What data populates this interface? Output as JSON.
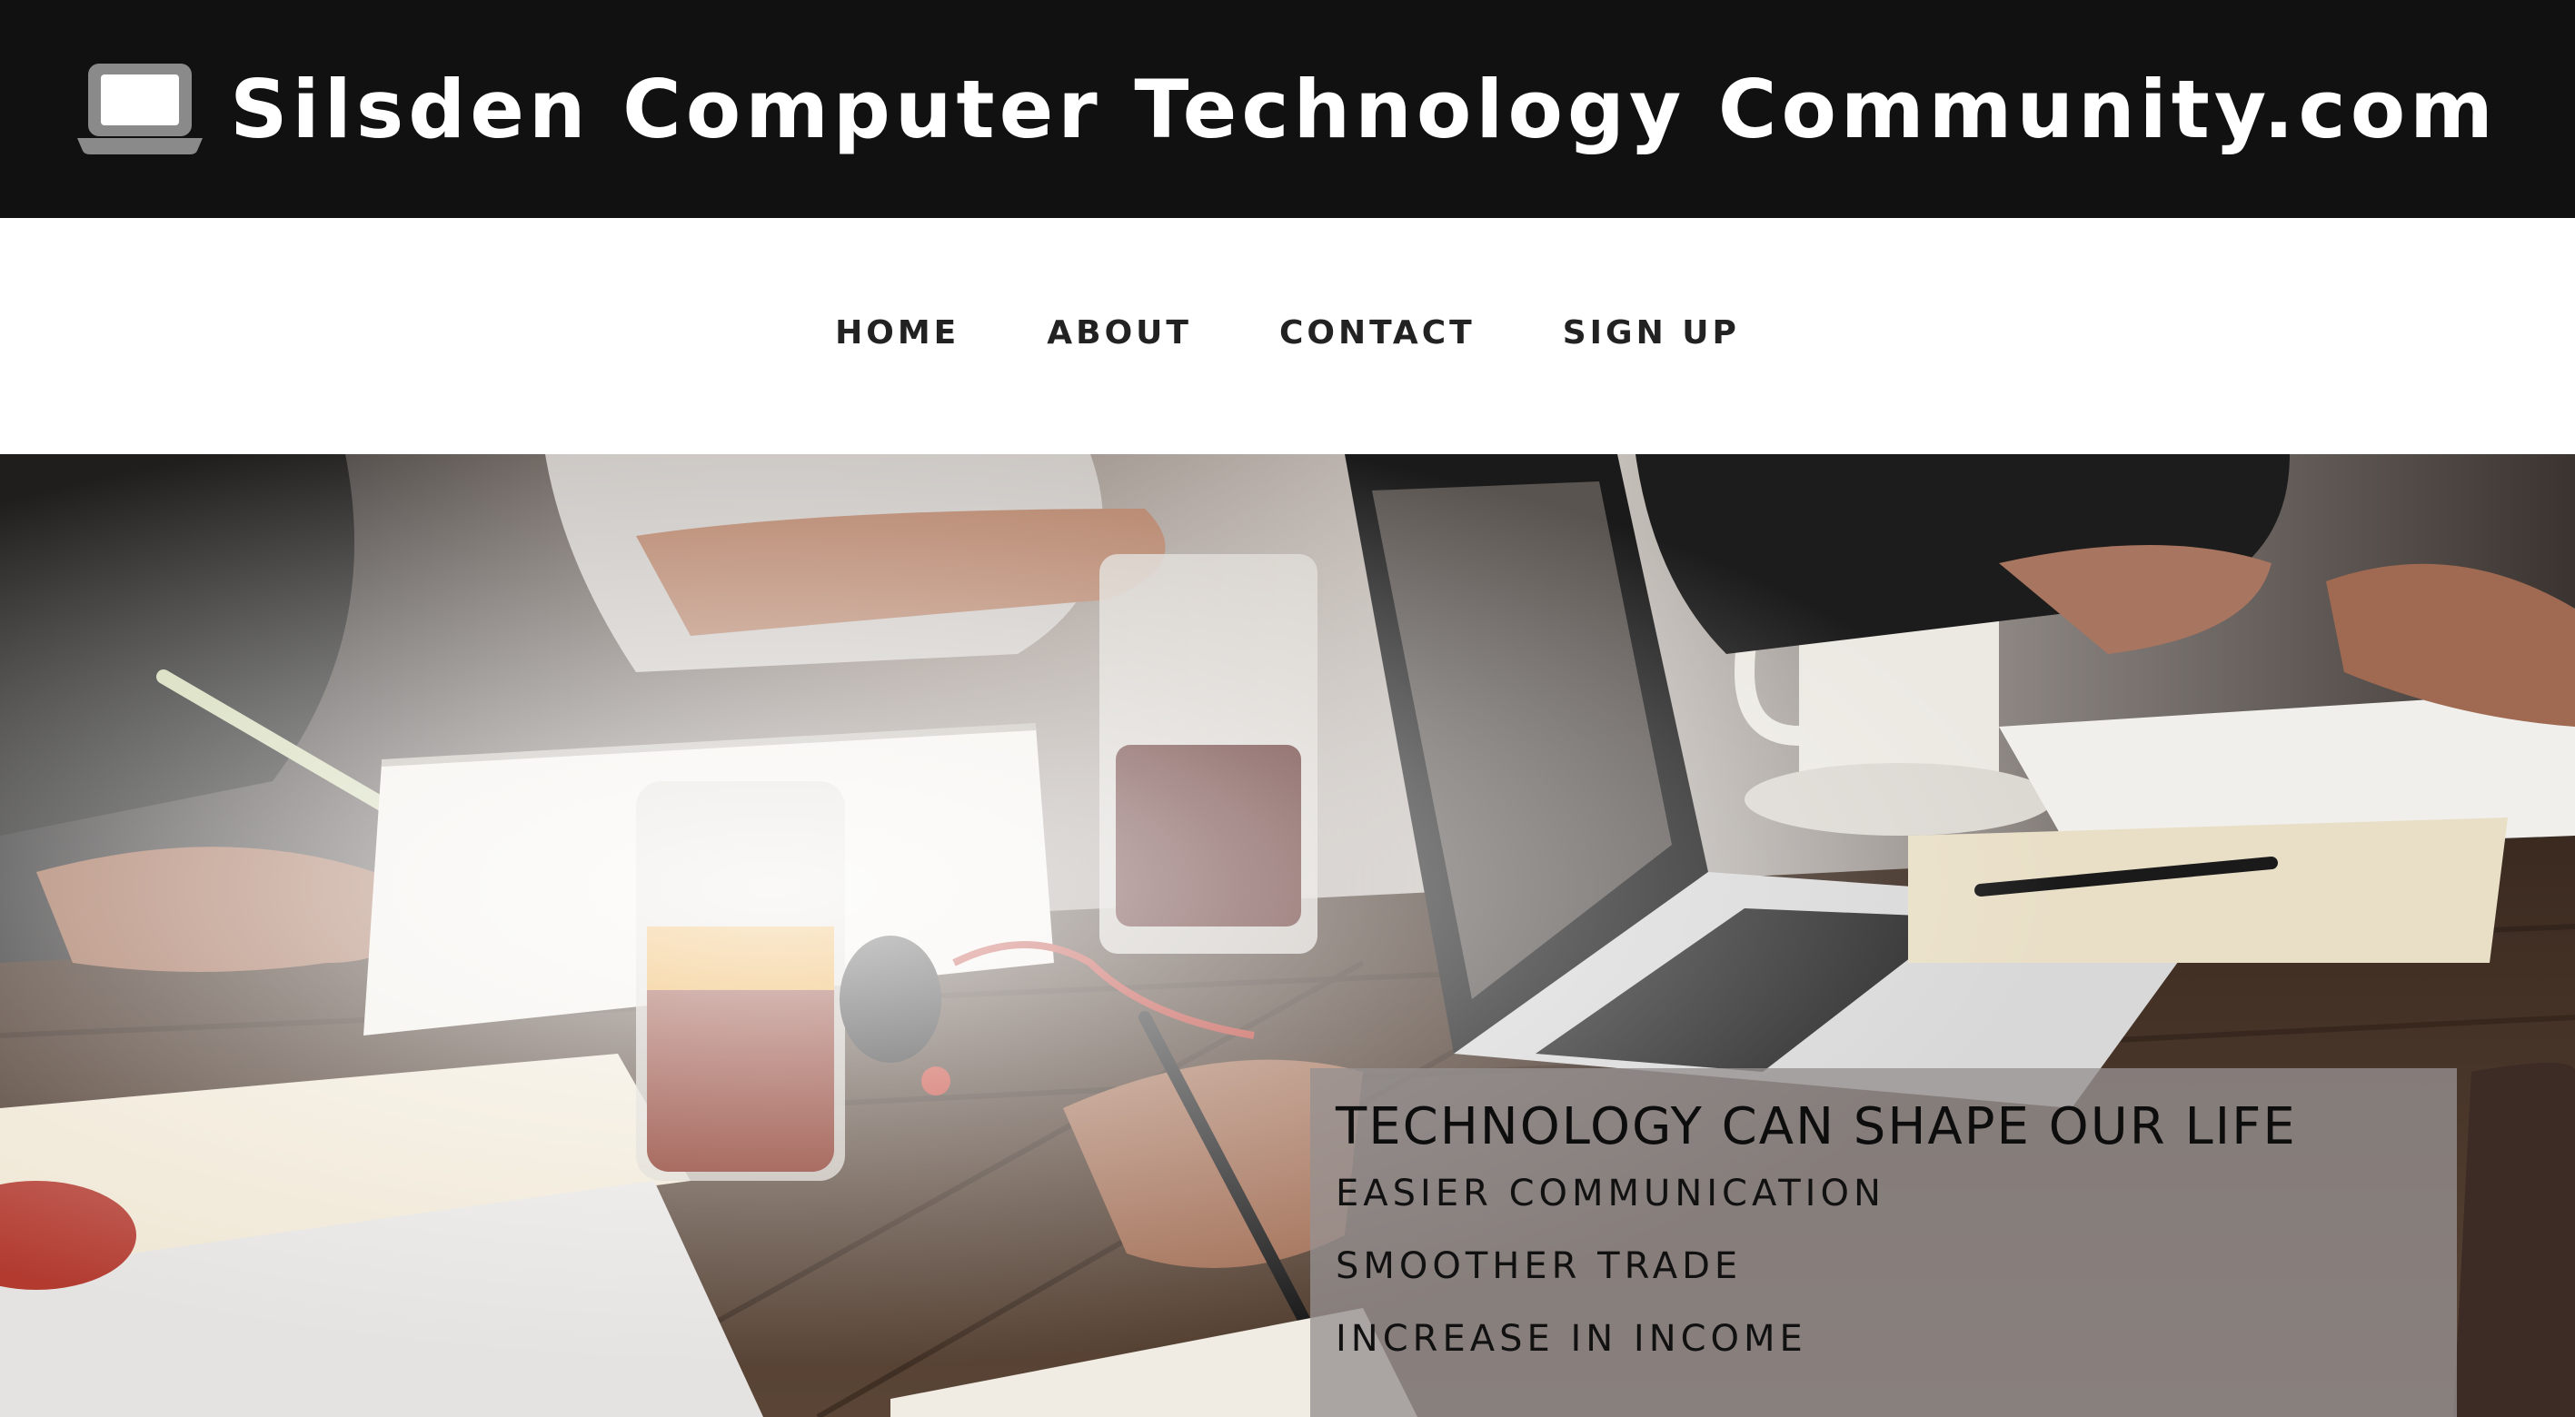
{
  "header": {
    "logo_icon": "laptop-icon",
    "title": "Silsden Computer Technology Community.com"
  },
  "nav": {
    "items": [
      {
        "label": "HOME"
      },
      {
        "label": "ABOUT"
      },
      {
        "label": "CONTACT"
      },
      {
        "label": "SIGN UP"
      }
    ]
  },
  "hero": {
    "image_alt": "people working at a table with laptops, notebooks and drinks",
    "caption": {
      "heading": "TECHNOLOGY CAN SHAPE OUR LIFE",
      "lines": [
        "EASIER COMMUNICATION",
        "SMOOTHER TRADE",
        "INCREASE IN INCOME"
      ]
    }
  },
  "colors": {
    "header_bg": "#111111",
    "header_text": "#ffffff",
    "nav_text": "#222222",
    "caption_bg": "rgba(150,145,145,0.78)"
  }
}
